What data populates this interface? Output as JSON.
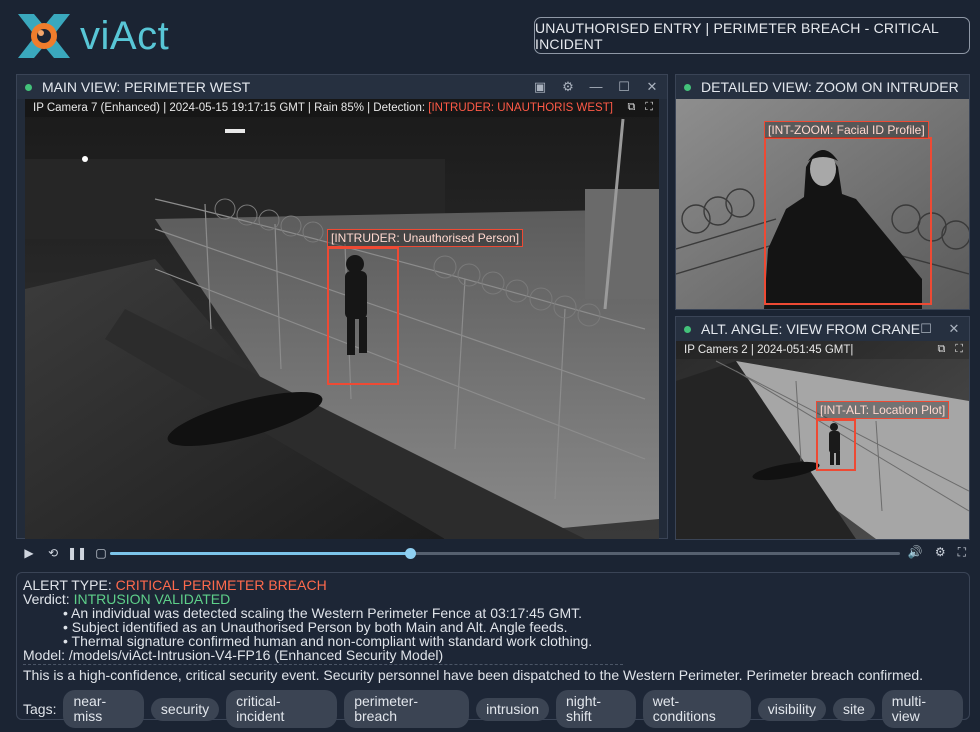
{
  "brand": {
    "logo_text": "viAct"
  },
  "incident_title": "UNAUTHORISED ENTRY | PERIMETER BREACH - CRITICAL INCIDENT",
  "main_panel": {
    "title": "MAIN VIEW: PERIMETER WEST",
    "caption_prefix": "IP Camera 7 (Enhanced) | 2024-05-15 19:17:15 GMT | Rain 85% | Detection: ",
    "caption_detection": "[INTRUDER: UNAUTHORIS WEST]",
    "bbox_label": "[INTRUDER: Unauthorised Person]"
  },
  "detail_panel": {
    "title": "DETAILED VIEW: ZOOM ON INTRUDER",
    "bbox_label": "[INT-ZOOM: Facial ID Profile]"
  },
  "alt_panel": {
    "title": "ALT. ANGLE: VIEW FROM CRANE",
    "caption": "IP Camers 2 | 2024-051:45 GMT|",
    "bbox_label": "[INT-ALT: Location Plot]"
  },
  "player": {
    "progress": 0.38
  },
  "alert": {
    "type_label": "ALERT TYPE: ",
    "type_value": "CRITICAL PERIMETER BREACH",
    "verdict_label": "Verdict: ",
    "verdict_value": "INTRUSION VALIDATED",
    "bullets": [
      "• An individual was detected scaling the Western Perimeter Fence at 03:17:45 GMT.",
      "• Subject identified as an Unauthorised Person by both Main and Alt. Angle feeds.",
      "• Thermal signature confirmed human and non-compliant with standard work clothing."
    ],
    "model": "Model: /models/viAct-Intrusion-V4-FP16 (Enhanced Security Model)",
    "summary": "This is a high-confidence, critical security event. Security personnel have been dispatched to the Western Perimeter. Perimeter breach confirmed.",
    "tags_label": "Tags:",
    "tags": [
      "near-miss",
      "security",
      "critical-incident",
      "perimeter-breach",
      "intrusion",
      "night-shift",
      "wet-conditions",
      "visibility",
      "site",
      "multi-view"
    ]
  },
  "colors": {
    "accent": "#58c6d6",
    "alert": "#ff6a4d",
    "ok": "#5ed08a",
    "bbox": "#ee4a34"
  }
}
